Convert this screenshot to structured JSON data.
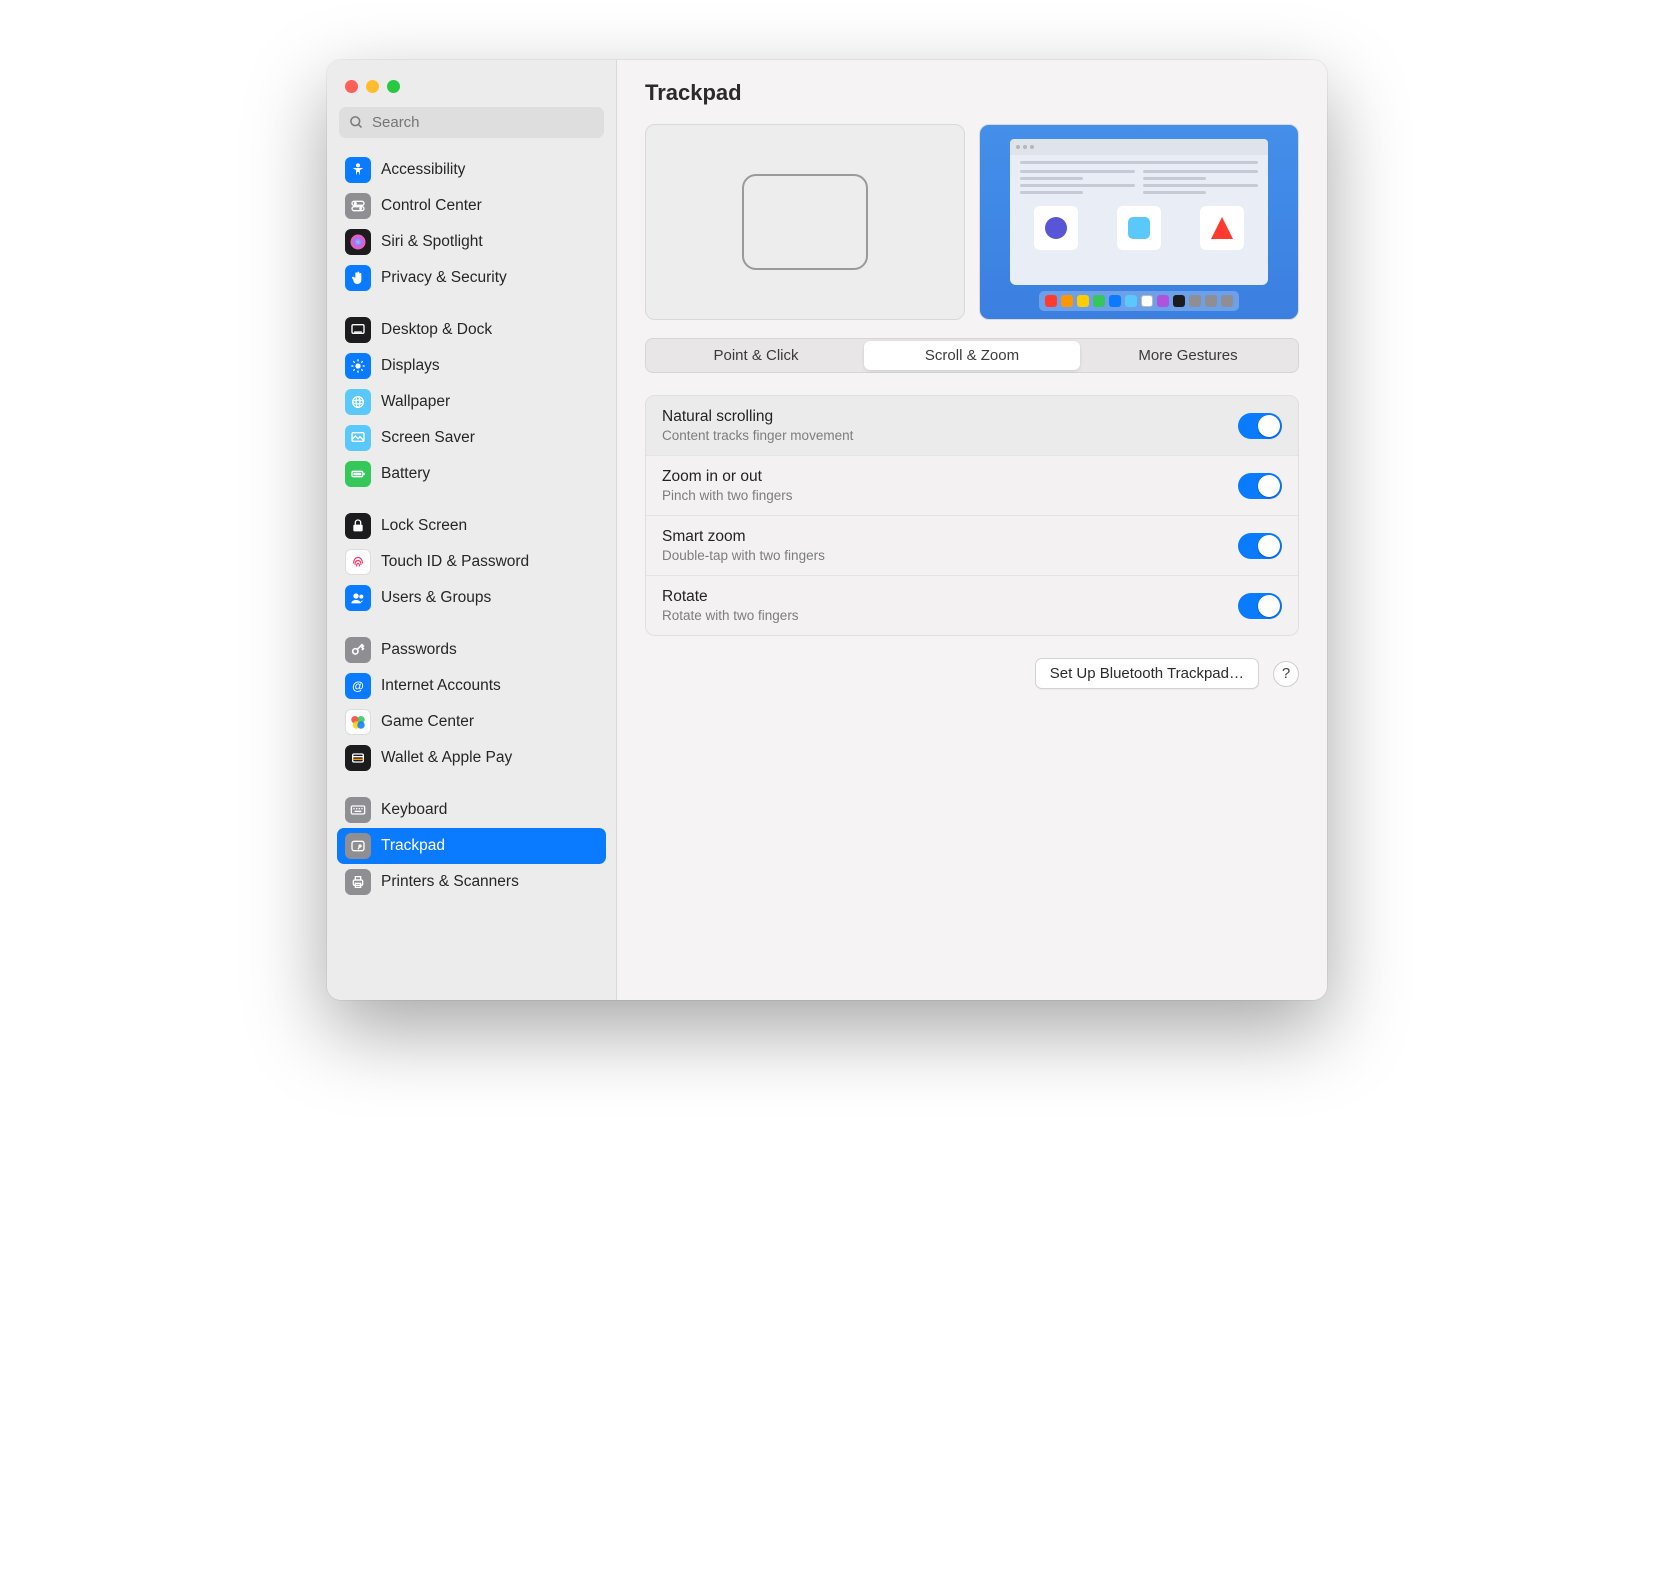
{
  "search": {
    "placeholder": "Search"
  },
  "sidebar": {
    "groups": [
      [
        {
          "label": "Accessibility",
          "icon": "accessibility-icon",
          "bg": "#0a7aff",
          "fg": "#fff"
        },
        {
          "label": "Control Center",
          "icon": "control-center-icon",
          "bg": "#8e8e93",
          "fg": "#fff"
        },
        {
          "label": "Siri & Spotlight",
          "icon": "siri-icon",
          "bg": "#1c1c1e",
          "fg": "#fff"
        },
        {
          "label": "Privacy & Security",
          "icon": "hand-icon",
          "bg": "#0a7aff",
          "fg": "#fff"
        }
      ],
      [
        {
          "label": "Desktop & Dock",
          "icon": "desktop-dock-icon",
          "bg": "#1c1c1e",
          "fg": "#fff"
        },
        {
          "label": "Displays",
          "icon": "displays-icon",
          "bg": "#0a7aff",
          "fg": "#fff"
        },
        {
          "label": "Wallpaper",
          "icon": "wallpaper-icon",
          "bg": "#5ac8fa",
          "fg": "#fff"
        },
        {
          "label": "Screen Saver",
          "icon": "screensaver-icon",
          "bg": "#5ac8fa",
          "fg": "#fff"
        },
        {
          "label": "Battery",
          "icon": "battery-icon",
          "bg": "#34c759",
          "fg": "#fff"
        }
      ],
      [
        {
          "label": "Lock Screen",
          "icon": "lock-icon",
          "bg": "#1c1c1e",
          "fg": "#fff"
        },
        {
          "label": "Touch ID & Password",
          "icon": "touchid-icon",
          "bg": "#ffffff",
          "fg": "#ff3b30"
        },
        {
          "label": "Users & Groups",
          "icon": "users-icon",
          "bg": "#0a7aff",
          "fg": "#fff"
        }
      ],
      [
        {
          "label": "Passwords",
          "icon": "key-icon",
          "bg": "#8e8e93",
          "fg": "#fff"
        },
        {
          "label": "Internet Accounts",
          "icon": "at-icon",
          "bg": "#0a7aff",
          "fg": "#fff"
        },
        {
          "label": "Game Center",
          "icon": "gamecenter-icon",
          "bg": "#ffffff",
          "fg": "#ff3b30"
        },
        {
          "label": "Wallet & Apple Pay",
          "icon": "wallet-icon",
          "bg": "#1c1c1e",
          "fg": "#fff"
        }
      ],
      [
        {
          "label": "Keyboard",
          "icon": "keyboard-icon",
          "bg": "#8e8e93",
          "fg": "#fff"
        },
        {
          "label": "Trackpad",
          "icon": "trackpad-icon",
          "bg": "#8e8e93",
          "fg": "#fff",
          "selected": true
        },
        {
          "label": "Printers & Scanners",
          "icon": "printer-icon",
          "bg": "#8e8e93",
          "fg": "#fff"
        }
      ]
    ]
  },
  "page": {
    "title": "Trackpad"
  },
  "tabs": [
    {
      "label": "Point & Click",
      "active": false
    },
    {
      "label": "Scroll & Zoom",
      "active": true
    },
    {
      "label": "More Gestures",
      "active": false
    }
  ],
  "settings": [
    {
      "title": "Natural scrolling",
      "sub": "Content tracks finger movement",
      "on": true
    },
    {
      "title": "Zoom in or out",
      "sub": "Pinch with two fingers",
      "on": true
    },
    {
      "title": "Smart zoom",
      "sub": "Double-tap with two fingers",
      "on": true
    },
    {
      "title": "Rotate",
      "sub": "Rotate with two fingers",
      "on": true
    }
  ],
  "footer": {
    "setup_button": "Set Up Bluetooth Trackpad…",
    "help": "?"
  },
  "dock_colors": [
    "#ff3b30",
    "#ff9500",
    "#ffcc00",
    "#34c759",
    "#0a7aff",
    "#5ac8fa",
    "#ffffff",
    "#af52de",
    "#1c1c1e",
    "#8e8e93",
    "#8e8e93",
    "#8e8e93"
  ]
}
